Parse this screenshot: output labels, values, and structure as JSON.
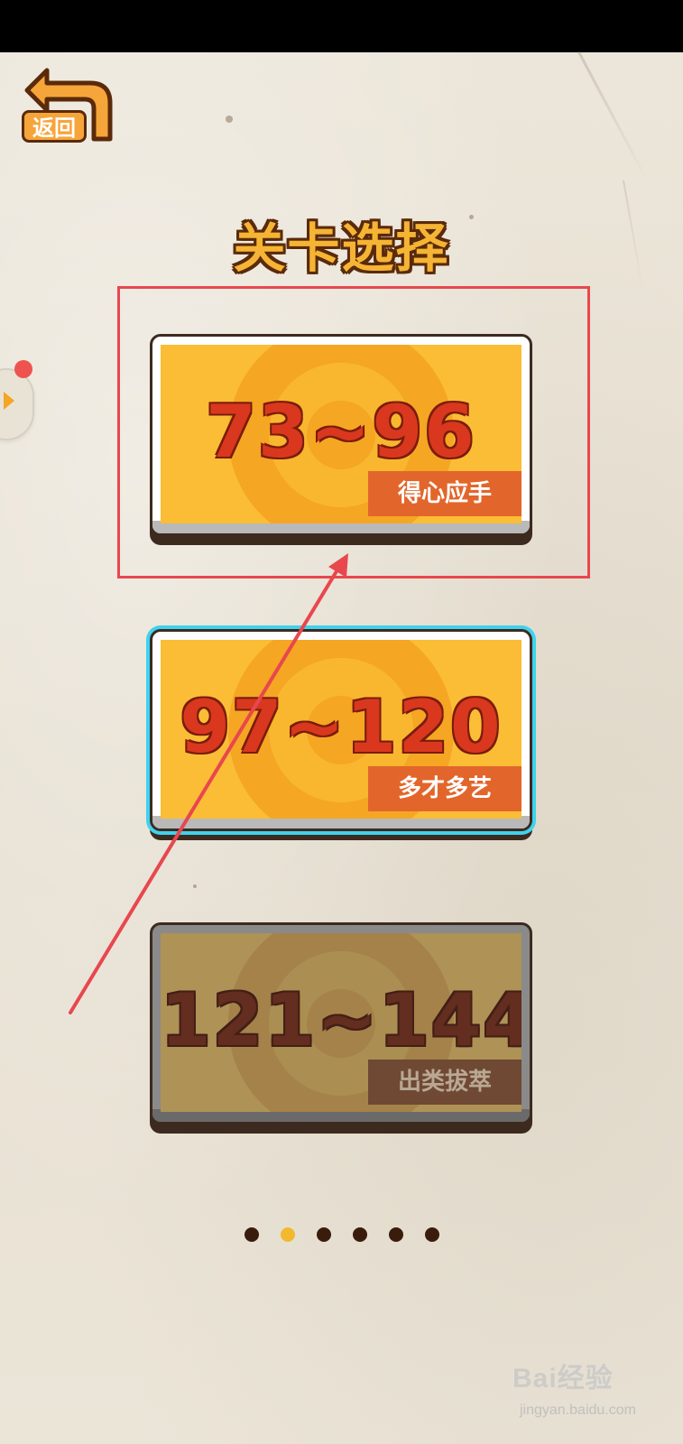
{
  "header": {
    "back_label": "返回",
    "title": "关卡选择"
  },
  "levels": [
    {
      "range": "73~96",
      "tag": "得心应手",
      "state": "available"
    },
    {
      "range": "97~120",
      "tag": "多才多艺",
      "state": "selected"
    },
    {
      "range": "121~144",
      "tag": "出类拔萃",
      "state": "locked"
    }
  ],
  "pager": {
    "count": 6,
    "active_index": 1
  },
  "watermark": {
    "brand": "Bai经验",
    "url": "jingyan.baidu.com"
  },
  "colors": {
    "title": "#f5b434",
    "card_orange": "#f5a623",
    "range_red": "#d9381e",
    "tag_orange": "#e2662b",
    "highlight": "#e8474e",
    "selected_glow": "#3fd2ef"
  }
}
